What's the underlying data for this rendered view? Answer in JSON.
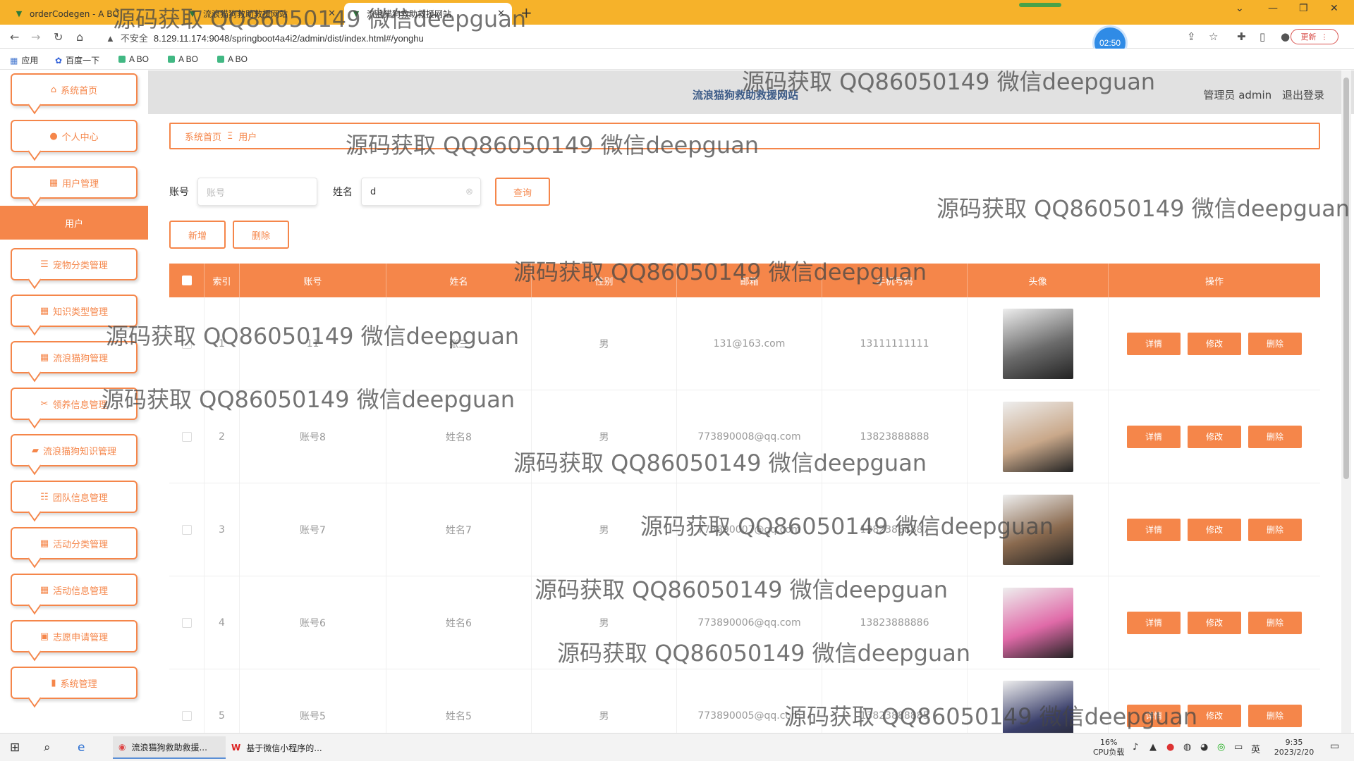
{
  "browser": {
    "tabs": [
      {
        "title": "orderCodegen - A BO",
        "active": false
      },
      {
        "title": "流浪猫狗救助救援网站",
        "active": false
      },
      {
        "title": "流浪猫狗救助救援网站",
        "active": true
      }
    ],
    "new_tab_icon": "plus-icon",
    "url_insecure_label": "不安全",
    "url": "8.129.11.174:9048/springboot4a4i2/admin/dist/index.html#/yonghu",
    "timer": "02:50",
    "update_label": "更新",
    "bookmarks": [
      "应用",
      "百度一下",
      "A BO",
      "A BO",
      "A BO"
    ]
  },
  "header": {
    "site_title": "流浪猫狗救助救援网站",
    "admin_label": "管理员 admin",
    "logout_label": "退出登录"
  },
  "sidebar": {
    "items": [
      {
        "label": "系统首页",
        "icon": "home-icon"
      },
      {
        "label": "个人中心",
        "icon": "user-icon"
      },
      {
        "label": "用户管理",
        "icon": "grid-icon"
      },
      {
        "label": "宠物分类管理",
        "icon": "list-icon"
      },
      {
        "label": "知识类型管理",
        "icon": "grid-icon"
      },
      {
        "label": "流浪猫狗管理",
        "icon": "grid-icon"
      },
      {
        "label": "领养信息管理",
        "icon": "ticket-icon"
      },
      {
        "label": "流浪猫狗知识管理",
        "icon": "briefcase-icon"
      },
      {
        "label": "团队信息管理",
        "icon": "sliders-icon"
      },
      {
        "label": "活动分类管理",
        "icon": "grid-icon"
      },
      {
        "label": "活动信息管理",
        "icon": "grid-icon"
      },
      {
        "label": "志愿申请管理",
        "icon": "clipboard-icon"
      },
      {
        "label": "系统管理",
        "icon": "bar-chart-icon"
      }
    ],
    "active_sub": "用户"
  },
  "breadcrumb": {
    "home": "系统首页",
    "separator": "Ξ",
    "current": "用户"
  },
  "search": {
    "account_label": "账号",
    "account_placeholder": "账号",
    "name_label": "姓名",
    "name_value": "d",
    "query_button": "查询"
  },
  "actions": {
    "add": "新增",
    "delete": "删除"
  },
  "table": {
    "columns": [
      "索引",
      "账号",
      "姓名",
      "性别",
      "邮箱",
      "手机号码",
      "头像",
      "操作"
    ],
    "op_labels": {
      "detail": "详情",
      "edit": "修改",
      "delete": "删除"
    },
    "rows": [
      {
        "index": "1",
        "account": "11",
        "name": "张三",
        "gender": "男",
        "email": "131@163.com",
        "phone": "13111111111",
        "avatar_color": "#6b6b6b"
      },
      {
        "index": "2",
        "account": "账号8",
        "name": "姓名8",
        "gender": "男",
        "email": "773890008@qq.com",
        "phone": "13823888888",
        "avatar_color": "#c9a88a"
      },
      {
        "index": "3",
        "account": "账号7",
        "name": "姓名7",
        "gender": "男",
        "email": "773890007@qq.com",
        "phone": "13823888887",
        "avatar_color": "#8a6a4f"
      },
      {
        "index": "4",
        "account": "账号6",
        "name": "姓名6",
        "gender": "男",
        "email": "773890006@qq.com",
        "phone": "13823888886",
        "avatar_color": "#e06aa8"
      },
      {
        "index": "5",
        "account": "账号5",
        "name": "姓名5",
        "gender": "男",
        "email": "773890005@qq.com",
        "phone": "13823888885",
        "avatar_color": "#3a3f6b"
      }
    ]
  },
  "watermark": "源码获取 QQ86050149 微信deepguan",
  "taskbar": {
    "apps": [
      "流浪猫狗救助救援...",
      "基于微信小程序的..."
    ],
    "cpu_percent": "16%",
    "cpu_label": "CPU负载",
    "ime": "英",
    "time": "9:35",
    "date": "2023/2/20"
  }
}
